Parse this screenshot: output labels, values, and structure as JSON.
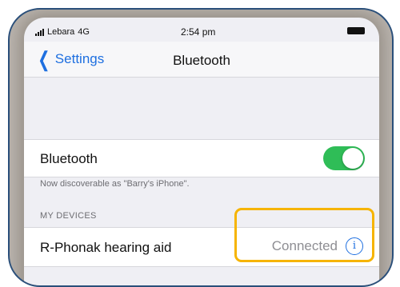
{
  "status_bar": {
    "carrier": "Lebara",
    "network": "4G",
    "time": "2:54 pm",
    "icons": [
      "signal-icon",
      "battery-icon"
    ]
  },
  "nav": {
    "back_label": "Settings",
    "title": "Bluetooth"
  },
  "bluetooth_row": {
    "label": "Bluetooth",
    "toggle_on": true,
    "toggle_color": "#2fbd57"
  },
  "discoverable_note": "Now discoverable as \"Barry's iPhone\".",
  "devices_section": {
    "header": "MY DEVICES",
    "items": [
      {
        "name": "R-Phonak hearing aid",
        "status": "Connected",
        "icon": "info-icon"
      }
    ]
  },
  "colors": {
    "accent": "#1e6fe0",
    "highlight": "#f6b400",
    "frame_border": "#2a4f7a"
  }
}
